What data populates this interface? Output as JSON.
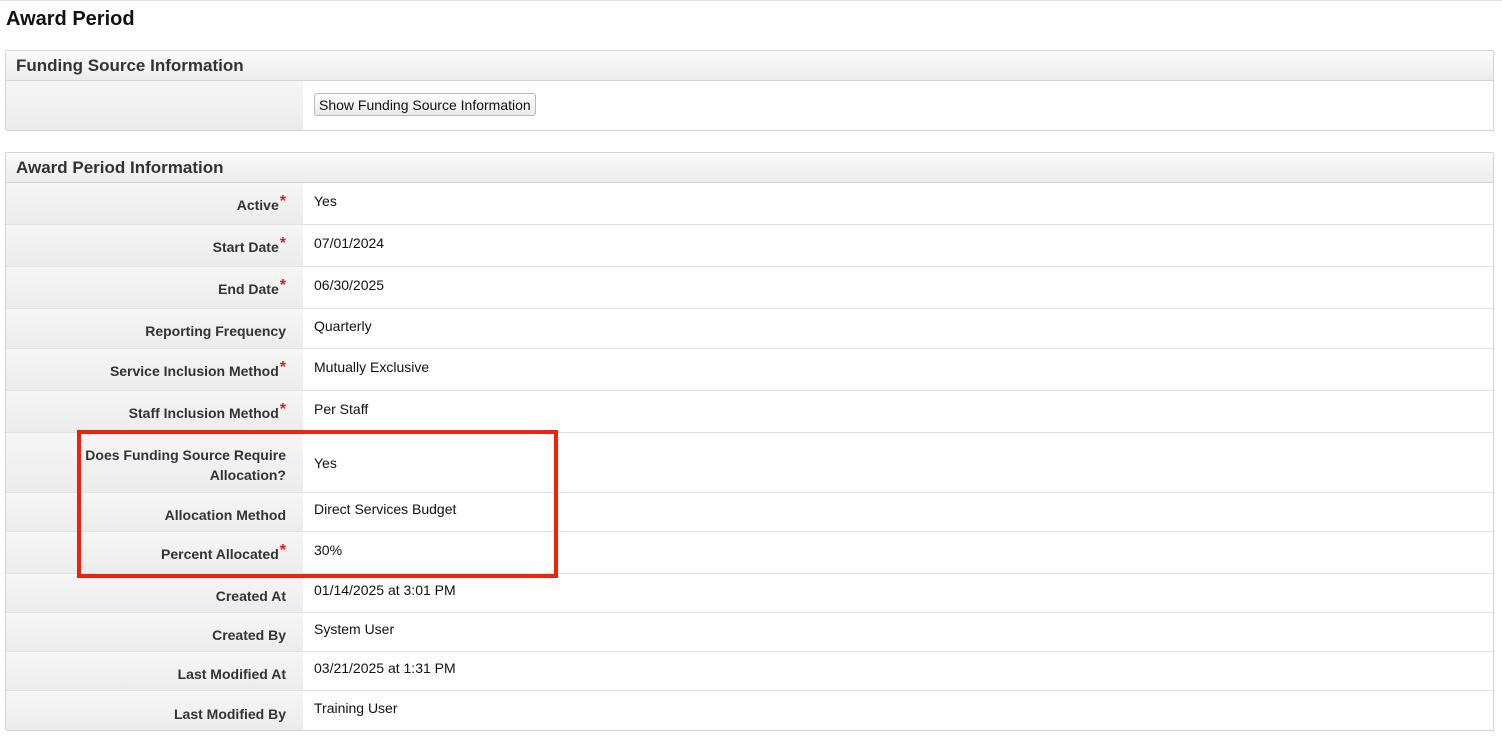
{
  "page": {
    "title": "Award Period"
  },
  "funding_panel": {
    "title": "Funding Source Information",
    "show_button_label": "Show Funding Source Information"
  },
  "award_panel": {
    "title": "Award Period Information",
    "rows": [
      {
        "label": "Active",
        "value": "Yes",
        "required": "*"
      },
      {
        "label": "Start Date",
        "value": "07/01/2024",
        "required": "*"
      },
      {
        "label": "End Date",
        "value": "06/30/2025",
        "required": "*"
      },
      {
        "label": "Reporting Frequency",
        "value": "Quarterly"
      },
      {
        "label": "Service Inclusion Method",
        "value": "Mutually Exclusive",
        "required": "*"
      },
      {
        "label": "Staff Inclusion Method",
        "value": "Per Staff",
        "required": "*"
      },
      {
        "label": "Does Funding Source Require Allocation?",
        "value": "Yes"
      },
      {
        "label": "Allocation Method",
        "value": "Direct Services Budget"
      },
      {
        "label": "Percent Allocated",
        "value": "30%",
        "required": "*"
      },
      {
        "label": "Created At",
        "value": "01/14/2025 at 3:01 PM"
      },
      {
        "label": "Created By",
        "value": "System User"
      },
      {
        "label": "Last Modified At",
        "value": "03/21/2025 at 1:31 PM"
      },
      {
        "label": "Last Modified By",
        "value": "Training User"
      }
    ]
  },
  "colors": {
    "highlight": "#f2200d",
    "required_marker": "#e21b1b"
  }
}
